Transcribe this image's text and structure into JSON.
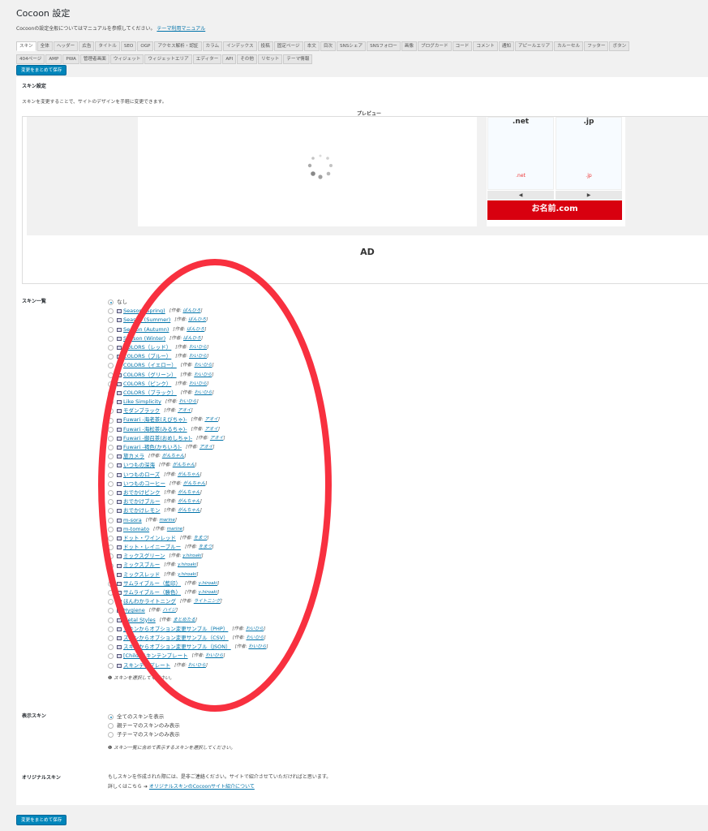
{
  "title": "Cocoon 設定",
  "manual": {
    "text": "Cocoonの設定全般についてはマニュアルを参照してください。",
    "link": "テーマ利用マニュアル"
  },
  "tabs": [
    "スキン",
    "全体",
    "ヘッダー",
    "広告",
    "タイトル",
    "SEO",
    "OGP",
    "アクセス解析・認証",
    "カラム",
    "インデックス",
    "投稿",
    "固定ページ",
    "本文",
    "目次",
    "SNSシェア",
    "SNSフォロー",
    "画像",
    "ブログカード",
    "コード",
    "コメント",
    "通知",
    "アピールエリア",
    "カルーセル",
    "フッター",
    "ボタン",
    "404ページ",
    "AMP",
    "PWA",
    "管理者画面",
    "ウィジェット",
    "ウィジェットエリア",
    "エディター",
    "API",
    "その他",
    "リセット",
    "テーマ情報"
  ],
  "active_tab": "スキン",
  "save_label": "変更をまとめて保存",
  "section": {
    "title": "スキン設定",
    "desc": "スキンを変更することで、サイトのデザインを手軽に変更できます。",
    "preview_label": "プレビュー"
  },
  "ad": {
    "cells": [
      ".net",
      ".jp"
    ],
    "prev": "◀",
    "next": "▶",
    "banner": "お名前.com",
    "text": "AD"
  },
  "skin_list": {
    "label": "スキン一覧",
    "author_prefix": "[作者: ",
    "selected": "なし",
    "items": [
      [
        "Season (Spring)",
        "ばんひろ"
      ],
      [
        "Season (Summer)",
        "ばんひろ"
      ],
      [
        "Season (Autumn)",
        "ばんひろ"
      ],
      [
        "Season (Winter)",
        "ばんひろ"
      ],
      [
        "COLORS（レッド）",
        "わいひら"
      ],
      [
        "COLORS（ブルー）",
        "わいひら"
      ],
      [
        "COLORS（イエロー）",
        "わいひら"
      ],
      [
        "COLORS（グリーン）",
        "わいひら"
      ],
      [
        "COLORS（ピンク）",
        "わいひら"
      ],
      [
        "COLORS（ブラック）",
        "わいひら"
      ],
      [
        "Like Simplicity",
        "わいひら"
      ],
      [
        "モダンブラック",
        "アオイ"
      ],
      [
        "Fuwari -海老茶(えびちゃ)-",
        "アオイ"
      ],
      [
        "Fuwari -海松茶(みるちゃ)-",
        "アオイ"
      ],
      [
        "Fuwari -御召茶(おめしちゃ)-",
        "アオイ"
      ],
      [
        "Fuwari -褐色(かちいろ)-",
        "アオイ"
      ],
      [
        "旅カメラ",
        "がんちゃん"
      ],
      [
        "いつもの深海",
        "がんちゃん"
      ],
      [
        "いつものローズ",
        "がんちゃん"
      ],
      [
        "いつものコーヒー",
        "がんちゃん"
      ],
      [
        "おでかけピンク",
        "がんちゃん"
      ],
      [
        "おでかけブルー",
        "がんちゃん"
      ],
      [
        "おでかけレモン",
        "がんちゃん"
      ],
      [
        "m-sora",
        "marine"
      ],
      [
        "m-tomato",
        "marine"
      ],
      [
        "ドット・ワインレッド",
        "をまつ"
      ],
      [
        "ドット・レイニーブルー",
        "をまつ"
      ],
      [
        "ミックスグリーン",
        "y.hiroaki"
      ],
      [
        "ミックスブルー",
        "y.hiroaki"
      ],
      [
        "ミックスレッド",
        "y.hiroaki"
      ],
      [
        "サムライブルー（藍印）",
        "y.hiroaki"
      ],
      [
        "サムライブルー（勝色）",
        "y.hiroaki"
      ],
      [
        "ほんわかライトニング",
        "ライトニング"
      ],
      [
        "Hygiene",
        "ハイジ"
      ],
      [
        "Metal Styles",
        "まとめたる"
      ],
      [
        "スキンからオプション変更サンプル（PHP）",
        "わいひら"
      ],
      [
        "スキンからオプション変更サンプル（CSV）",
        "わいひら"
      ],
      [
        "スキンからオプション変更サンプル（JSON）",
        "わいひら"
      ],
      [
        "[Child]スキンテンプレート",
        "わいひら"
      ],
      [
        "スキンテンプレート",
        "わいひら"
      ]
    ],
    "note": "スキンを選択してください。"
  },
  "display_skin": {
    "label": "表示スキン",
    "options": [
      "全てのスキンを表示",
      "親テーマのスキンのみ表示",
      "子テーマのスキンのみ表示"
    ],
    "selected": "全てのスキンを表示",
    "note": "スキン一覧に含めて表示するスキンを選択してください。"
  },
  "original_skin": {
    "label": "オリジナルスキン",
    "text": "もしスキンを作成された際には、是非ご連絡ください。サイトで紹介させていただければと思います。",
    "more": "詳しくはこちら",
    "link": "オリジナルスキンのCocoonサイト紹介について"
  },
  "colors": {
    "primary": "#0085ba",
    "annotation": "#f8303f",
    "link": "#0073aa"
  }
}
